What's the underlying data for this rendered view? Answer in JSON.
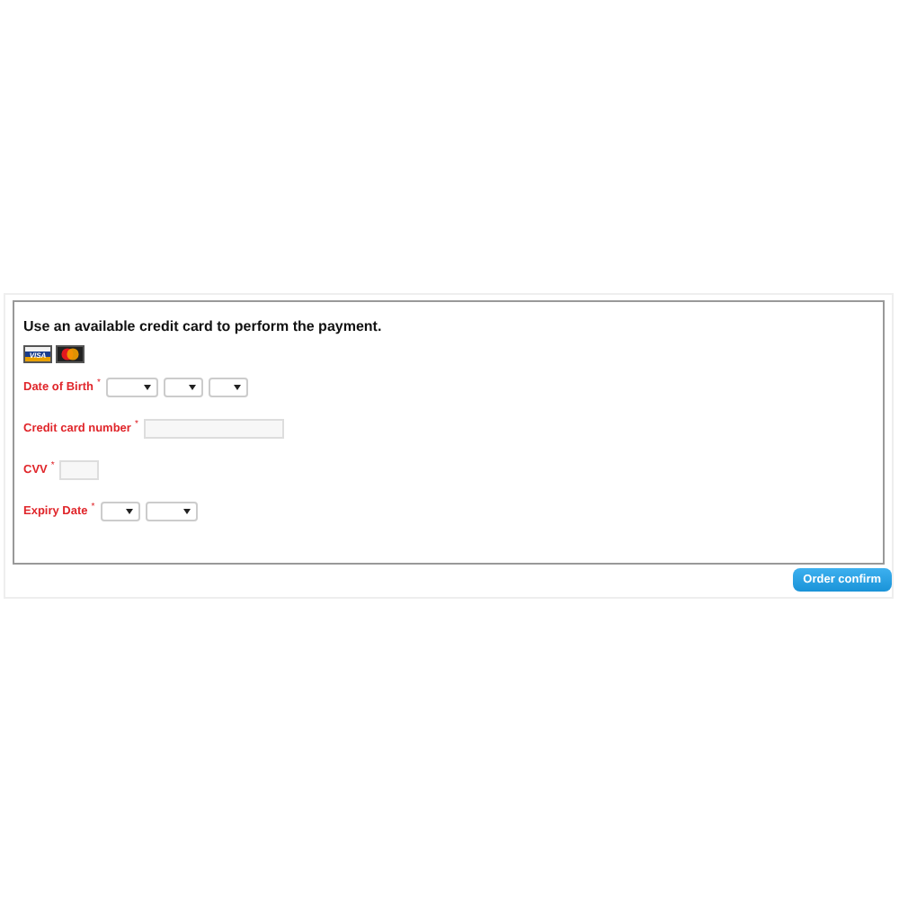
{
  "heading": "Use an available credit card to perform the payment.",
  "cards": [
    {
      "kind": "visa",
      "label": "VISA"
    },
    {
      "kind": "mastercard"
    }
  ],
  "fields": [
    {
      "label": "Date of Birth",
      "mark": "*",
      "controls": [
        {
          "kind": "select"
        },
        {
          "kind": "select"
        },
        {
          "kind": "select"
        }
      ]
    },
    {
      "label": "Credit card number",
      "mark": "*",
      "controls": [
        {
          "kind": "text"
        }
      ]
    },
    {
      "label": "CVV",
      "mark": "*",
      "controls": [
        {
          "kind": "text"
        }
      ]
    },
    {
      "label": "Expiry Date",
      "mark": "*",
      "controls": [
        {
          "kind": "select"
        },
        {
          "kind": "select"
        }
      ]
    }
  ],
  "button": "Order confirm"
}
